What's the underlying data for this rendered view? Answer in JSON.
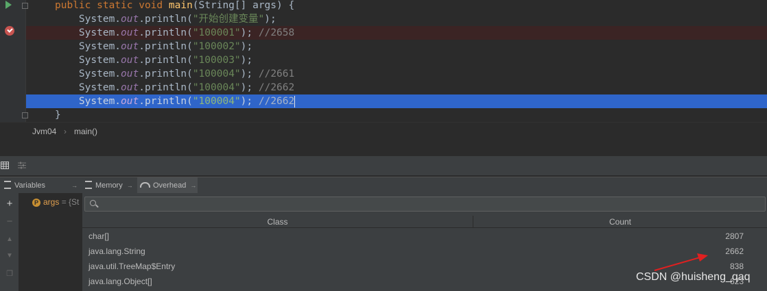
{
  "editor": {
    "lines": [
      {
        "parts": [
          [
            "kw",
            "public static void "
          ],
          [
            "fn",
            "main"
          ],
          [
            "pl",
            "(String[] args) {"
          ]
        ]
      },
      {
        "parts": [
          [
            "pl",
            "    System."
          ],
          [
            "fld",
            "out"
          ],
          [
            "pl",
            ".println("
          ],
          [
            "str",
            "\"开始创建变量\""
          ],
          [
            "pl",
            ");"
          ]
        ]
      },
      {
        "parts": [
          [
            "pl",
            "    System."
          ],
          [
            "fld",
            "out"
          ],
          [
            "pl",
            ".println("
          ],
          [
            "str",
            "\"100001\""
          ],
          [
            "pl",
            "); "
          ],
          [
            "cm",
            "//2658"
          ]
        ]
      },
      {
        "parts": [
          [
            "pl",
            "    System."
          ],
          [
            "fld",
            "out"
          ],
          [
            "pl",
            ".println("
          ],
          [
            "str",
            "\"100002\""
          ],
          [
            "pl",
            ");"
          ]
        ]
      },
      {
        "parts": [
          [
            "pl",
            "    System."
          ],
          [
            "fld",
            "out"
          ],
          [
            "pl",
            ".println("
          ],
          [
            "str",
            "\"100003\""
          ],
          [
            "pl",
            ");"
          ]
        ]
      },
      {
        "parts": [
          [
            "pl",
            "    System."
          ],
          [
            "fld",
            "out"
          ],
          [
            "pl",
            ".println("
          ],
          [
            "str",
            "\"100004\""
          ],
          [
            "pl",
            "); "
          ],
          [
            "cm",
            "//2661"
          ]
        ]
      },
      {
        "parts": [
          [
            "pl",
            "    System."
          ],
          [
            "fld",
            "out"
          ],
          [
            "pl",
            ".println("
          ],
          [
            "str",
            "\"100004\""
          ],
          [
            "pl",
            "); "
          ],
          [
            "cm",
            "//2662"
          ]
        ]
      },
      {
        "parts": [
          [
            "pl",
            "    System."
          ],
          [
            "fld",
            "out"
          ],
          [
            "pl",
            ".println("
          ],
          [
            "str",
            "\"100004\""
          ],
          [
            "pl",
            "); "
          ],
          [
            "cm",
            "//2662"
          ]
        ]
      },
      {
        "parts": [
          [
            "pl",
            "}"
          ]
        ]
      }
    ]
  },
  "breadcrumb": {
    "class_name": "Jvm04",
    "separator": "›",
    "method": "main()"
  },
  "debug_tabs": {
    "variables": "Variables",
    "memory": "Memory",
    "overhead": "Overhead",
    "pin_glyph": "→"
  },
  "variables": {
    "name": "args",
    "value": "= {St",
    "badge": "P"
  },
  "memory": {
    "search_placeholder": "",
    "columns": {
      "class": "Class",
      "count": "Count"
    },
    "rows": [
      {
        "class": "char[]",
        "count": "2807"
      },
      {
        "class": "java.lang.String",
        "count": "2662"
      },
      {
        "class": "java.util.TreeMap$Entry",
        "count": "838"
      },
      {
        "class": "java.lang.Object[]",
        "count": "623"
      }
    ]
  },
  "watermark": "CSDN @huisheng_qaq",
  "colors": {
    "keyword": "#cc7832",
    "string": "#6a8759",
    "comment": "#808080",
    "selection": "#2f65ca",
    "breakpoint": "#c75450",
    "arrow": "#e02020"
  }
}
